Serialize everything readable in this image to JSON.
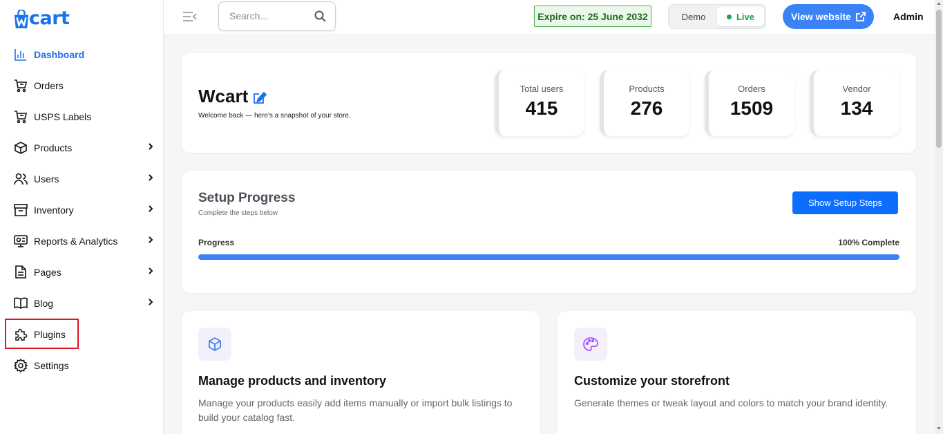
{
  "logo": {
    "text": "cart",
    "brand_color": "#1a73e8"
  },
  "sidebar": {
    "items": [
      {
        "label": "Dashboard",
        "icon": "bar-chart-icon",
        "active": true,
        "has_submenu": false
      },
      {
        "label": "Orders",
        "icon": "cart-icon",
        "active": false,
        "has_submenu": false
      },
      {
        "label": "USPS Labels",
        "icon": "cart-icon",
        "active": false,
        "has_submenu": false
      },
      {
        "label": "Products",
        "icon": "box-icon",
        "active": false,
        "has_submenu": true
      },
      {
        "label": "Users",
        "icon": "users-icon",
        "active": false,
        "has_submenu": true
      },
      {
        "label": "Inventory",
        "icon": "archive-icon",
        "active": false,
        "has_submenu": true
      },
      {
        "label": "Reports & Analytics",
        "icon": "report-icon",
        "active": false,
        "has_submenu": true
      },
      {
        "label": "Pages",
        "icon": "file-icon",
        "active": false,
        "has_submenu": true
      },
      {
        "label": "Blog",
        "icon": "book-icon",
        "active": false,
        "has_submenu": true
      },
      {
        "label": "Plugins",
        "icon": "puzzle-icon",
        "active": false,
        "has_submenu": false,
        "highlighted": true
      },
      {
        "label": "Settings",
        "icon": "gear-icon",
        "active": false,
        "has_submenu": false
      }
    ]
  },
  "topbar": {
    "search_placeholder": "Search...",
    "expire_text": "Expire on: 25 June 2032",
    "mode_demo": "Demo",
    "mode_live": "Live",
    "view_website": "View website",
    "user": "Admin"
  },
  "welcome": {
    "title": "Wcart",
    "subtitle": "Welcome back — here's a snapshot of your store.",
    "stats": [
      {
        "label": "Total users",
        "value": "415"
      },
      {
        "label": "Products",
        "value": "276"
      },
      {
        "label": "Orders",
        "value": "1509"
      },
      {
        "label": "Vendor",
        "value": "134"
      }
    ]
  },
  "setup": {
    "title": "Setup Progress",
    "subtitle": "Complete the steps below",
    "button": "Show Setup Steps",
    "progress_label": "Progress",
    "progress_text": "100% Complete",
    "progress_fraction": 1.0
  },
  "features": [
    {
      "title": "Manage products and inventory",
      "desc": "Manage your products easily add items manually or import bulk listings to build your catalog fast.",
      "icon": "cube-icon"
    },
    {
      "title": "Customize your storefront",
      "desc": "Generate themes or tweak layout and colors to match your brand identity.",
      "icon": "palette-icon"
    }
  ],
  "colors": {
    "accent": "#3b82f6",
    "active_nav": "#1a73e8",
    "live": "#1aa34a",
    "highlight_border": "#e0131f"
  }
}
